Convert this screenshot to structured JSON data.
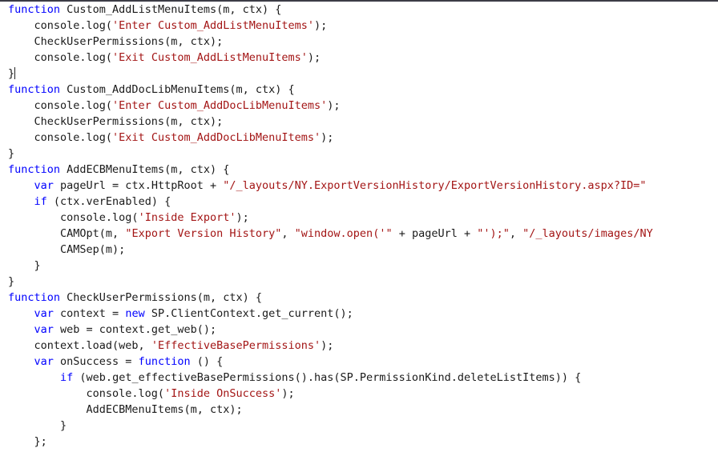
{
  "editor": {
    "kind": "code-editor-viewport",
    "language": "javascript",
    "background_color": "#ffffff",
    "foreground_color": "#1a1a1a",
    "keyword_color": "#0000ff",
    "string_color": "#a31515",
    "top_rule_color": "#3c3c46",
    "font_size_px": 13.5,
    "line_height_px": 20,
    "indent_spaces": 4,
    "word_wrap": "off",
    "caret_line_index": 4,
    "caret_after_text": "}"
  },
  "lines": [
    {
      "index": 0,
      "tokens": [
        {
          "t": "keyword",
          "v": "function"
        },
        {
          "t": "plain",
          "v": " Custom_AddListMenuItems(m, ctx) {"
        }
      ]
    },
    {
      "index": 1,
      "tokens": [
        {
          "t": "plain",
          "v": "    console.log("
        },
        {
          "t": "string",
          "v": "'Enter Custom_AddListMenuItems'"
        },
        {
          "t": "plain",
          "v": ");"
        }
      ]
    },
    {
      "index": 2,
      "tokens": [
        {
          "t": "plain",
          "v": "    CheckUserPermissions(m, ctx);"
        }
      ]
    },
    {
      "index": 3,
      "tokens": [
        {
          "t": "plain",
          "v": "    console.log("
        },
        {
          "t": "string",
          "v": "'Exit Custom_AddListMenuItems'"
        },
        {
          "t": "plain",
          "v": ");"
        }
      ]
    },
    {
      "index": 4,
      "caret": true,
      "tokens": [
        {
          "t": "plain",
          "v": "}"
        }
      ]
    },
    {
      "index": 5,
      "tokens": [
        {
          "t": "keyword",
          "v": "function"
        },
        {
          "t": "plain",
          "v": " Custom_AddDocLibMenuItems(m, ctx) {"
        }
      ]
    },
    {
      "index": 6,
      "tokens": [
        {
          "t": "plain",
          "v": "    console.log("
        },
        {
          "t": "string",
          "v": "'Enter Custom_AddDocLibMenuItems'"
        },
        {
          "t": "plain",
          "v": ");"
        }
      ]
    },
    {
      "index": 7,
      "tokens": [
        {
          "t": "plain",
          "v": "    CheckUserPermissions(m, ctx);"
        }
      ]
    },
    {
      "index": 8,
      "tokens": [
        {
          "t": "plain",
          "v": "    console.log("
        },
        {
          "t": "string",
          "v": "'Exit Custom_AddDocLibMenuItems'"
        },
        {
          "t": "plain",
          "v": ");"
        }
      ]
    },
    {
      "index": 9,
      "tokens": [
        {
          "t": "plain",
          "v": "}"
        }
      ]
    },
    {
      "index": 10,
      "tokens": [
        {
          "t": "keyword",
          "v": "function"
        },
        {
          "t": "plain",
          "v": " AddECBMenuItems(m, ctx) {"
        }
      ]
    },
    {
      "index": 11,
      "tokens": [
        {
          "t": "plain",
          "v": "    "
        },
        {
          "t": "keyword",
          "v": "var"
        },
        {
          "t": "plain",
          "v": " pageUrl = ctx.HttpRoot + "
        },
        {
          "t": "string",
          "v": "\"/_layouts/NY.ExportVersionHistory/ExportVersionHistory.aspx?ID=\""
        }
      ]
    },
    {
      "index": 12,
      "tokens": [
        {
          "t": "plain",
          "v": "    "
        },
        {
          "t": "keyword",
          "v": "if"
        },
        {
          "t": "plain",
          "v": " (ctx.verEnabled) {"
        }
      ]
    },
    {
      "index": 13,
      "tokens": [
        {
          "t": "plain",
          "v": "        console.log("
        },
        {
          "t": "string",
          "v": "'Inside Export'"
        },
        {
          "t": "plain",
          "v": ");"
        }
      ]
    },
    {
      "index": 14,
      "tokens": [
        {
          "t": "plain",
          "v": "        CAMOpt(m, "
        },
        {
          "t": "string",
          "v": "\"Export Version History\""
        },
        {
          "t": "plain",
          "v": ", "
        },
        {
          "t": "string",
          "v": "\"window.open('\""
        },
        {
          "t": "plain",
          "v": " + pageUrl + "
        },
        {
          "t": "string",
          "v": "\"');\""
        },
        {
          "t": "plain",
          "v": ", "
        },
        {
          "t": "string",
          "v": "\"/_layouts/images/NY"
        }
      ]
    },
    {
      "index": 15,
      "tokens": [
        {
          "t": "plain",
          "v": "        CAMSep(m);"
        }
      ]
    },
    {
      "index": 16,
      "tokens": [
        {
          "t": "plain",
          "v": "    }"
        }
      ]
    },
    {
      "index": 17,
      "tokens": [
        {
          "t": "plain",
          "v": "}"
        }
      ]
    },
    {
      "index": 18,
      "tokens": [
        {
          "t": "keyword",
          "v": "function"
        },
        {
          "t": "plain",
          "v": " CheckUserPermissions(m, ctx) {"
        }
      ]
    },
    {
      "index": 19,
      "tokens": [
        {
          "t": "plain",
          "v": "    "
        },
        {
          "t": "keyword",
          "v": "var"
        },
        {
          "t": "plain",
          "v": " context = "
        },
        {
          "t": "keyword",
          "v": "new"
        },
        {
          "t": "plain",
          "v": " SP.ClientContext.get_current();"
        }
      ]
    },
    {
      "index": 20,
      "tokens": [
        {
          "t": "plain",
          "v": "    "
        },
        {
          "t": "keyword",
          "v": "var"
        },
        {
          "t": "plain",
          "v": " web = context.get_web();"
        }
      ]
    },
    {
      "index": 21,
      "tokens": [
        {
          "t": "plain",
          "v": "    context.load(web, "
        },
        {
          "t": "string",
          "v": "'EffectiveBasePermissions'"
        },
        {
          "t": "plain",
          "v": ");"
        }
      ]
    },
    {
      "index": 22,
      "tokens": [
        {
          "t": "plain",
          "v": "    "
        },
        {
          "t": "keyword",
          "v": "var"
        },
        {
          "t": "plain",
          "v": " onSuccess = "
        },
        {
          "t": "keyword",
          "v": "function"
        },
        {
          "t": "plain",
          "v": " () {"
        }
      ]
    },
    {
      "index": 23,
      "tokens": [
        {
          "t": "plain",
          "v": "        "
        },
        {
          "t": "keyword",
          "v": "if"
        },
        {
          "t": "plain",
          "v": " (web.get_effectiveBasePermissions().has(SP.PermissionKind.deleteListItems)) {"
        }
      ]
    },
    {
      "index": 24,
      "tokens": [
        {
          "t": "plain",
          "v": "            console.log("
        },
        {
          "t": "string",
          "v": "'Inside OnSuccess'"
        },
        {
          "t": "plain",
          "v": ");"
        }
      ]
    },
    {
      "index": 25,
      "tokens": [
        {
          "t": "plain",
          "v": "            AddECBMenuItems(m, ctx);"
        }
      ]
    },
    {
      "index": 26,
      "tokens": [
        {
          "t": "plain",
          "v": "        }"
        }
      ]
    },
    {
      "index": 27,
      "tokens": [
        {
          "t": "plain",
          "v": "    };"
        }
      ]
    },
    {
      "index": 28,
      "clipped": true,
      "tokens": [
        {
          "t": "plain",
          "v": ""
        }
      ]
    }
  ]
}
